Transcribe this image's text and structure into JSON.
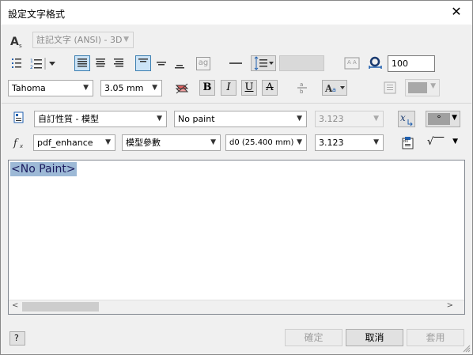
{
  "window": {
    "title": "設定文字格式",
    "close_glyph": "✕"
  },
  "row1": {
    "style_value": "註記文字 (ANSI) - 3D"
  },
  "row2": {
    "rotation_value": "100",
    "stack_label": "ag"
  },
  "row3": {
    "font_value": "Tahoma",
    "size_value": "3.05 mm",
    "bold_label": "B",
    "italic_label": "I",
    "underline_label": "U",
    "strike_label": "A"
  },
  "row4": {
    "param_source": "自訂性質 - 模型",
    "component": "No paint",
    "precision": "3.123",
    "symbol": "°"
  },
  "row5": {
    "function_name": "pdf_enhance",
    "param_type": "模型參數",
    "parameter": "d0 (25.400 mm)",
    "precision": "3.123",
    "sqrt_symbol": "√‾‾"
  },
  "editor": {
    "text": "<No Paint>"
  },
  "footer": {
    "ok": "確定",
    "cancel": "取消",
    "apply": "套用",
    "help": "?"
  },
  "colors": {
    "selection": "#9db9d6",
    "accent": "#3c7fb1"
  }
}
